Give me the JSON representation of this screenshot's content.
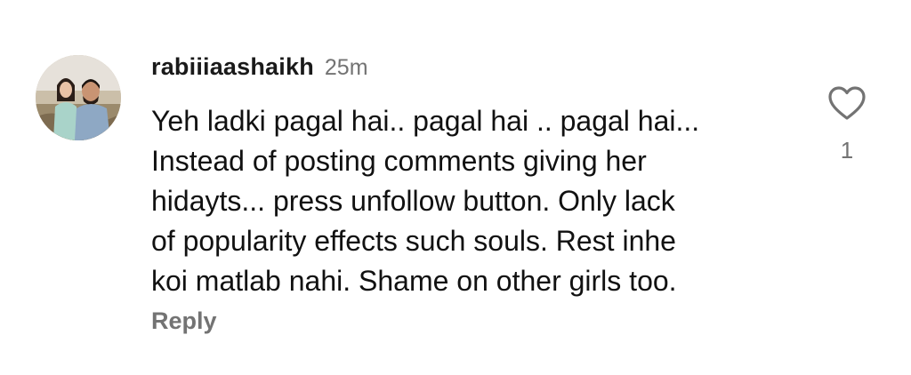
{
  "comment": {
    "username": "rabiiiaashaikh",
    "timestamp": "25m",
    "body": "Yeh ladki pagal hai.. pagal hai .. pagal hai...\nInstead of posting comments giving her\nhidayts... press unfollow button. Only lack\nof popularity effects such souls. Rest inhe\nkoi matlab nahi. Shame on other girls too.",
    "reply_label": "Reply",
    "like_count": "1",
    "icons": {
      "avatar": "user-avatar",
      "like": "heart-icon"
    },
    "colors": {
      "text": "#111111",
      "muted": "#737373",
      "background": "#ffffff"
    }
  }
}
